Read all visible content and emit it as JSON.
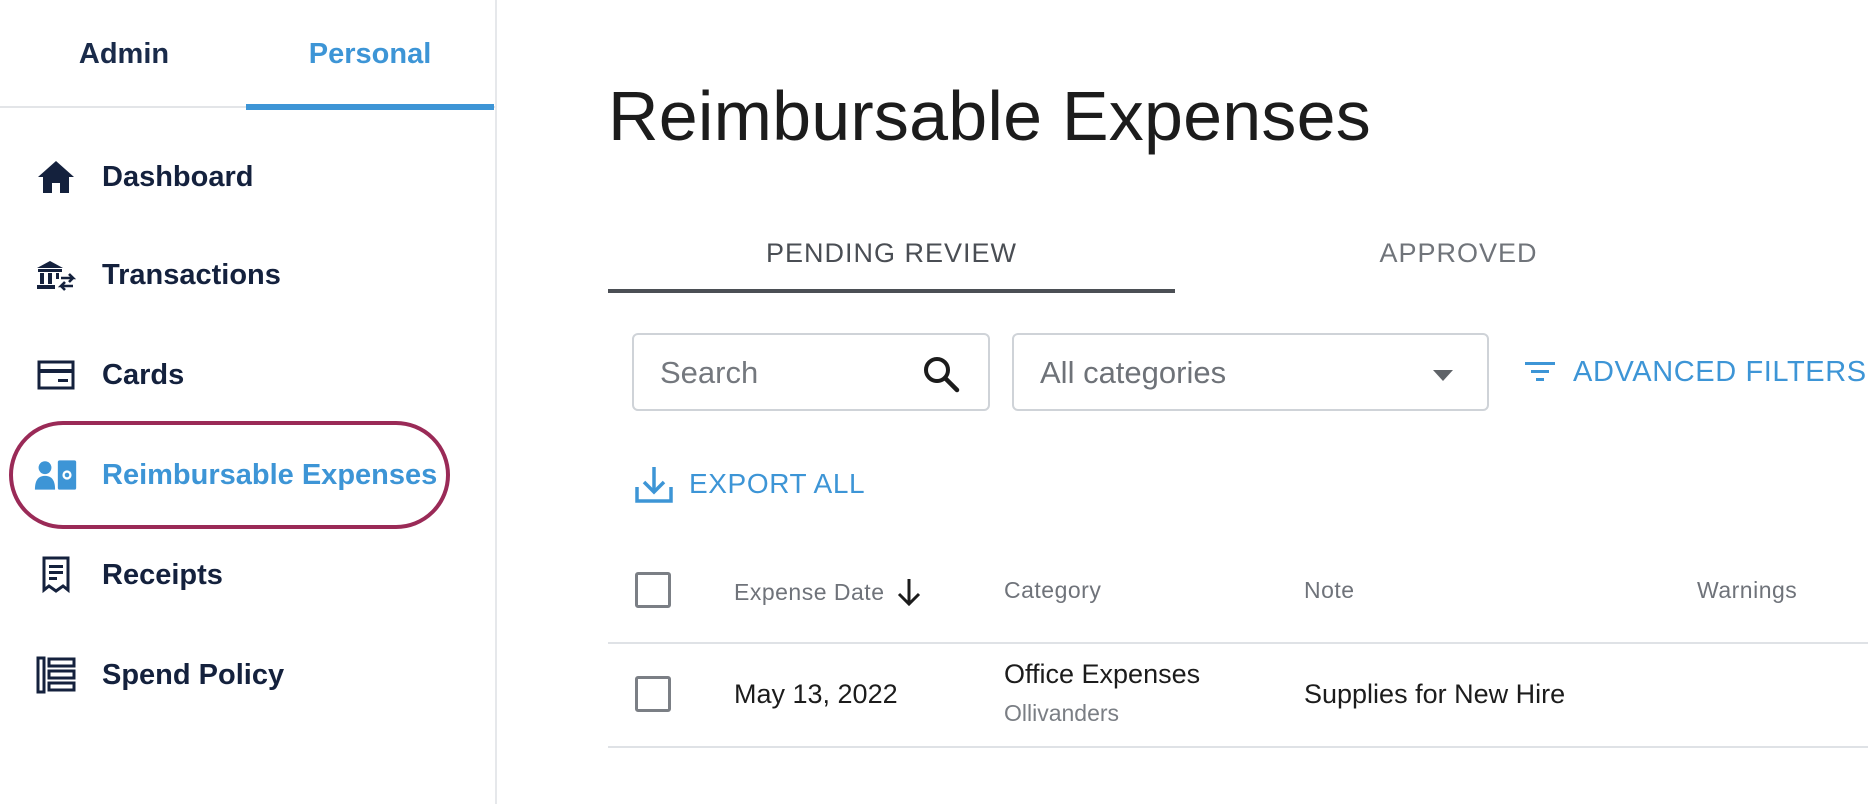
{
  "sidebar": {
    "mode_tabs": [
      {
        "label": "Admin",
        "active": false
      },
      {
        "label": "Personal",
        "active": true
      }
    ],
    "items": [
      {
        "label": "Dashboard",
        "icon": "home-icon"
      },
      {
        "label": "Transactions",
        "icon": "bank-transfer-icon"
      },
      {
        "label": "Cards",
        "icon": "card-icon"
      },
      {
        "label": "Reimbursable Expenses",
        "icon": "user-money-icon",
        "active": true
      },
      {
        "label": "Receipts",
        "icon": "receipt-icon"
      },
      {
        "label": "Spend Policy",
        "icon": "policy-list-icon"
      }
    ]
  },
  "main": {
    "title": "Reimbursable Expenses",
    "tabs": [
      {
        "label": "PENDING REVIEW",
        "active": true
      },
      {
        "label": "APPROVED",
        "active": false
      }
    ],
    "search": {
      "placeholder": "Search",
      "value": ""
    },
    "category_filter": {
      "selected": "All categories"
    },
    "advanced_filters_label": "ADVANCED FILTERS",
    "export_label": "EXPORT ALL",
    "table": {
      "columns": [
        "Expense Date",
        "Category",
        "Note",
        "Warnings"
      ],
      "sort": {
        "column": "Expense Date",
        "direction": "desc"
      },
      "rows": [
        {
          "date": "May 13, 2022",
          "category": "Office Expenses",
          "merchant": "Ollivanders",
          "note": "Supplies for New Hire",
          "warnings": ""
        }
      ]
    }
  },
  "colors": {
    "accent": "#3d95d6",
    "nav_text": "#14213d",
    "highlight_ring": "#9a2a57",
    "muted_text": "#6f737a"
  }
}
